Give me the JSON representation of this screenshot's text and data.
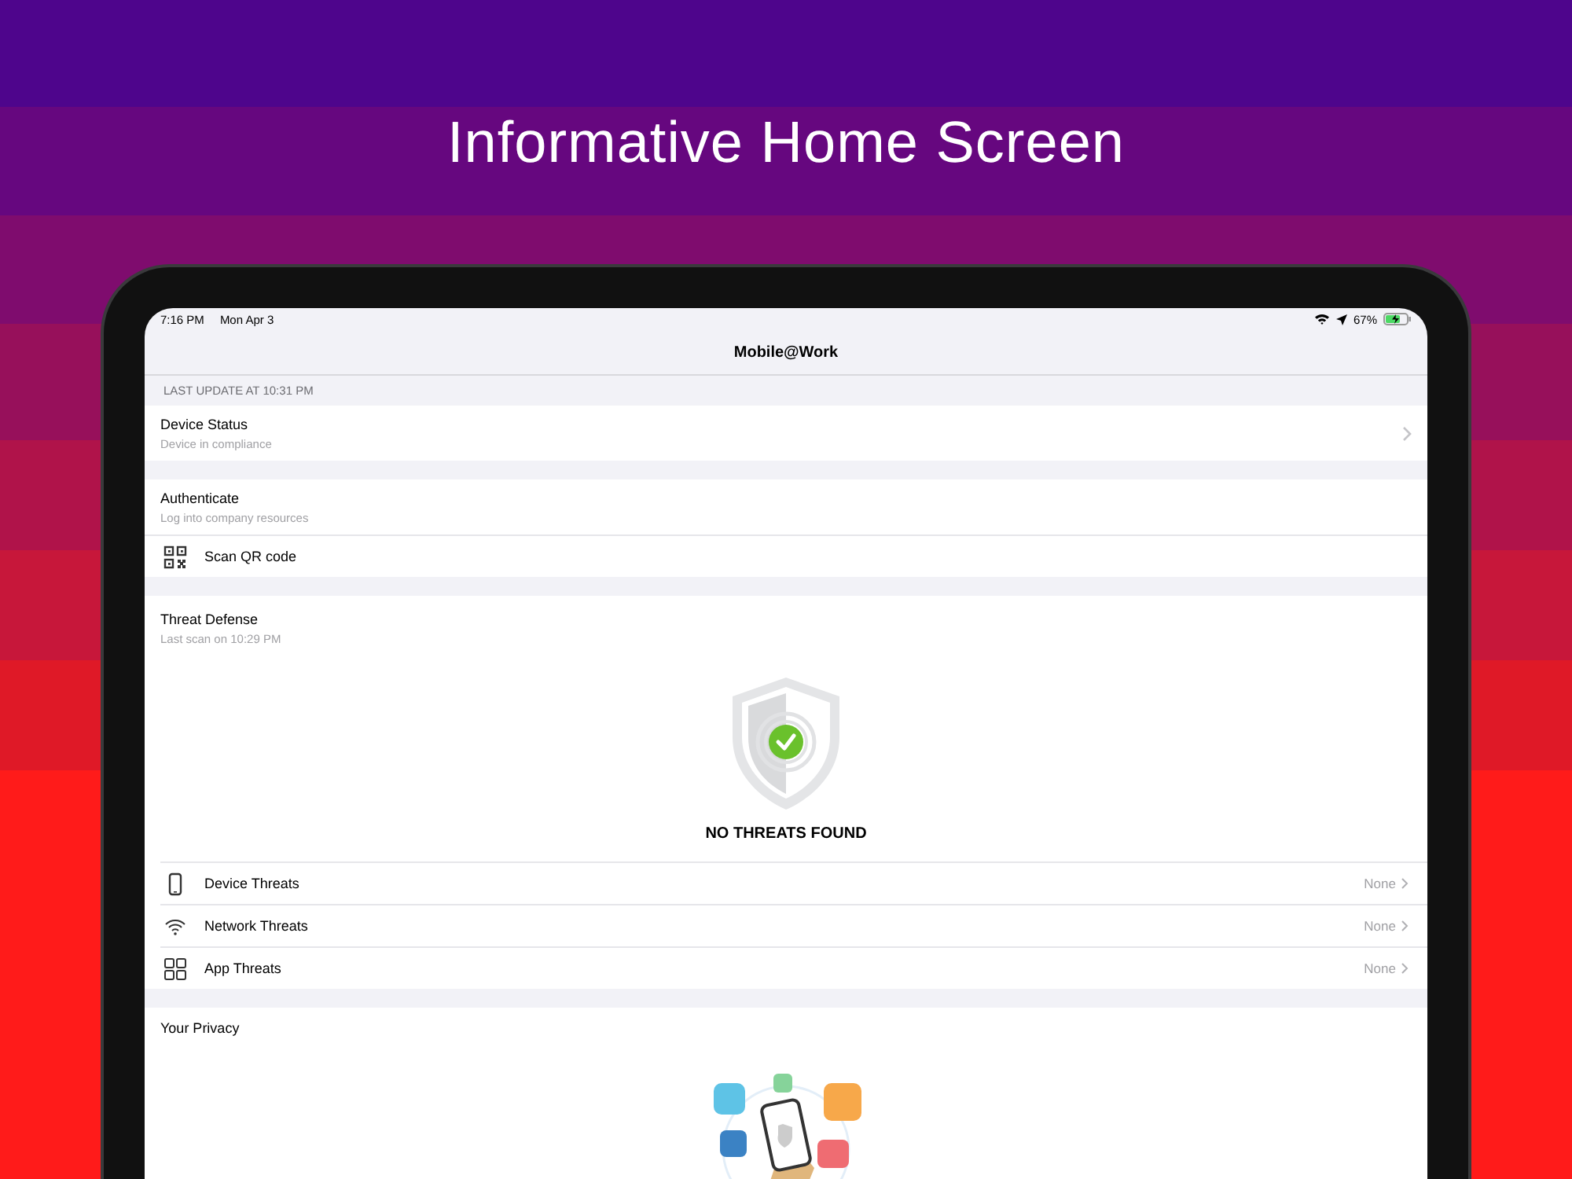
{
  "headline": "Informative Home Screen",
  "status_bar": {
    "time": "7:16 PM",
    "date": "Mon Apr 3",
    "battery": "67%"
  },
  "nav_title": "Mobile@Work",
  "section_header": "LAST UPDATE AT 10:31 PM",
  "device_status": {
    "title": "Device Status",
    "subtitle": "Device in compliance"
  },
  "authenticate": {
    "title": "Authenticate",
    "subtitle": "Log into company resources",
    "action": "Scan QR code"
  },
  "threat_defense": {
    "title": "Threat Defense",
    "subtitle": "Last scan on 10:29 PM",
    "result": "NO THREATS FOUND",
    "threats": [
      {
        "kind": "device",
        "label": "Device Threats",
        "value": "None"
      },
      {
        "kind": "network",
        "label": "Network Threats",
        "value": "None"
      },
      {
        "kind": "app",
        "label": "App Threats",
        "value": "None"
      }
    ]
  },
  "privacy": {
    "title": "Your Privacy"
  }
}
